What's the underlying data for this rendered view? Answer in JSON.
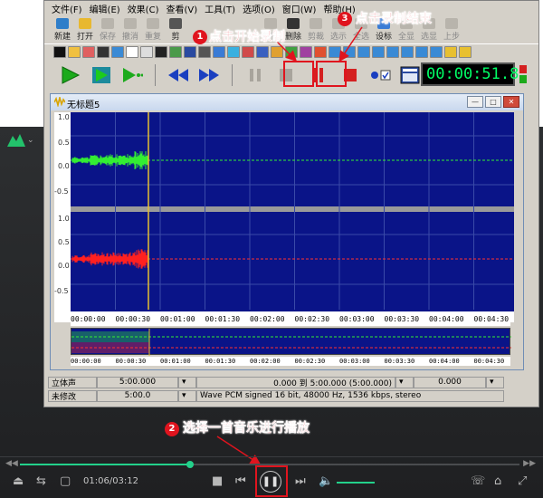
{
  "menu": [
    "文件(F)",
    "编辑(E)",
    "效果(C)",
    "查看(V)",
    "工具(T)",
    "选项(O)",
    "窗口(W)",
    "帮助(H)"
  ],
  "toolbar": {
    "left": [
      {
        "label": "新建",
        "icon": "new-file-icon",
        "color": "#2f7ec9"
      },
      {
        "label": "打开",
        "icon": "open-folder-icon",
        "color": "#e8b830"
      },
      {
        "label": "保存",
        "icon": "save-icon",
        "color": "",
        "dim": true
      },
      {
        "label": "撤消",
        "icon": "undo-icon",
        "color": "",
        "dim": true
      },
      {
        "label": "重复",
        "icon": "redo-icon",
        "color": "",
        "dim": true
      },
      {
        "label": "剪",
        "icon": "cut-icon",
        "color": "#333"
      }
    ],
    "right": [
      {
        "label": "替换",
        "icon": "replace-icon",
        "dim": true
      },
      {
        "label": "删除",
        "icon": "delete-icon",
        "dim": false
      },
      {
        "label": "剪裁",
        "icon": "trim-icon",
        "dim": true
      },
      {
        "label": "选示",
        "icon": "show-selection-icon",
        "dim": true
      },
      {
        "label": "全选",
        "icon": "select-all-icon",
        "dim": true
      },
      {
        "label": "设标",
        "icon": "set-marker-icon",
        "dim": false
      },
      {
        "label": "全显",
        "icon": "show-all-icon",
        "dim": true
      },
      {
        "label": "选显",
        "icon": "zoom-selection-icon",
        "dim": true
      },
      {
        "label": "上步",
        "icon": "prev-step-icon",
        "dim": true
      }
    ]
  },
  "time_display": "00:00:51.8",
  "document": {
    "title": "无标题5"
  },
  "y_axis": {
    "top_channel": [
      "1.0",
      "0.5",
      "0.0",
      "-0.5"
    ],
    "bottom_channel": [
      "1.0",
      "0.5",
      "0.0",
      "-0.5"
    ]
  },
  "timeline_ticks": [
    "00:00:00",
    "00:00:30",
    "00:01:00",
    "00:01:30",
    "00:02:00",
    "00:02:30",
    "00:03:00",
    "00:03:30",
    "00:04:00",
    "00:04:30"
  ],
  "status": {
    "row1": {
      "channel_mode": "立体声",
      "position": "5:00.000",
      "range": "0.000 到 5:00.000 (5:00.000)",
      "extra": "0.000"
    },
    "row2": {
      "modified": "未修改",
      "length": "5:00.0",
      "format": "Wave PCM signed 16 bit, 48000 Hz, 1536 kbps, stereo"
    }
  },
  "annotations": {
    "step1": {
      "number": "1",
      "text": "点击开始录制"
    },
    "step2": {
      "number": "2",
      "text": "选择一首音乐进行播放"
    },
    "step3": {
      "number": "3",
      "text": "点击录制结束"
    }
  },
  "player": {
    "time": "01:06/03:12",
    "progress": 0.34
  },
  "colors": {
    "waveform_background": "#0a1488",
    "channel_top_wave": "#33ee33",
    "channel_bottom_wave": "#ff2020",
    "annotation_red": "#e0141e",
    "player_accent": "#23d18b",
    "lcd_text": "#00ff66"
  }
}
